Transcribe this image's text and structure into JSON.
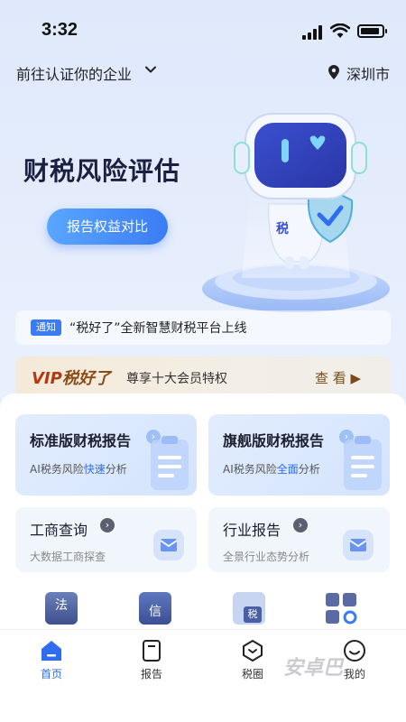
{
  "status_bar": {
    "time": "3:32"
  },
  "header": {
    "company_prompt": "前往认证你的企业",
    "city": "深圳市"
  },
  "hero": {
    "title": "财税风险评估",
    "button": "报告权益对比",
    "badge_char": "税"
  },
  "notice": {
    "tag": "通知",
    "text": "“税好了”全新智慧财税平台上线"
  },
  "vip": {
    "logo_prefix": "VIP",
    "logo_name": "税好了",
    "desc": "尊享十大会员特权",
    "link": "查 看 ▶"
  },
  "cards": {
    "standard": {
      "title": "标准版财税报告",
      "sub_pre": "AI税务风险",
      "sub_hl": "快速",
      "sub_post": "分析"
    },
    "flagship": {
      "title": "旗舰版财税报告",
      "sub_pre": "AI税务风险",
      "sub_hl": "全面",
      "sub_post": "分析"
    },
    "business": {
      "title": "工商查询",
      "sub": "大数据工商探查"
    },
    "industry": {
      "title": "行业报告",
      "sub": "全景行业态势分析"
    }
  },
  "quick_icons": {
    "law": "法",
    "credit": "信",
    "tax": "税"
  },
  "tabs": [
    {
      "label": "首页",
      "icon": "home-icon"
    },
    {
      "label": "报告",
      "icon": "report-icon"
    },
    {
      "label": "税圈",
      "icon": "tax-circle-icon"
    },
    {
      "label": "我的",
      "icon": "profile-icon"
    }
  ],
  "watermark": "安卓巴",
  "colors": {
    "accent": "#2f6cf0",
    "vip_brown": "#8a4b14"
  }
}
